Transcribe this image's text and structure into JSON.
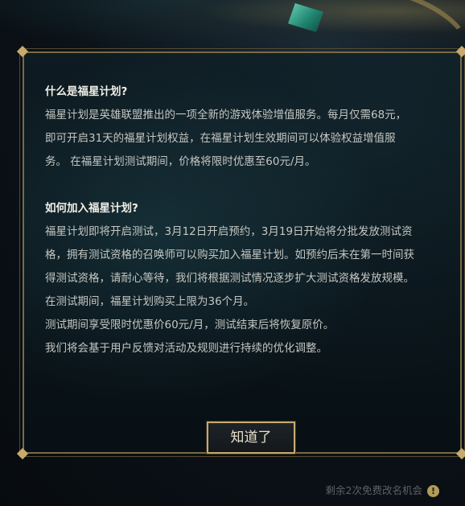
{
  "dialog": {
    "section1": {
      "heading": "什么是福星计划?",
      "lines": [
        "福星计划是英雄联盟推出的一项全新的游戏体验增值服务。每月仅需68元，",
        "即可开启31天的福星计划权益，在福星计划生效期间可以体验权益增值服",
        "务。 在福星计划测试期间，价格将限时优惠至60元/月。"
      ]
    },
    "section2": {
      "heading": "如何加入福星计划?",
      "lines": [
        "福星计划即将开启测试，3月12日开启预约，3月19日开始将分批发放测试资",
        "格，拥有测试资格的召唤师可以购买加入福星计划。如预约后未在第一时间获",
        "得测试资格，请耐心等待，我们将根据测试情况逐步扩大测试资格发放规模。",
        "在测试期间，福星计划购买上限为36个月。",
        "测试期间享受限时优惠价60元/月，测试结束后将恢复原价。",
        "我们将会基于用户反馈对活动及规则进行持续的优化调整。"
      ]
    },
    "ok_button_label": "知道了"
  },
  "footer": {
    "hint_text": "剩余2次免费改名机会",
    "info_icon_glyph": "!"
  },
  "colors": {
    "gold_border": "#c8aa6e",
    "text": "#c5c6c2",
    "heading": "#f0efe8"
  }
}
